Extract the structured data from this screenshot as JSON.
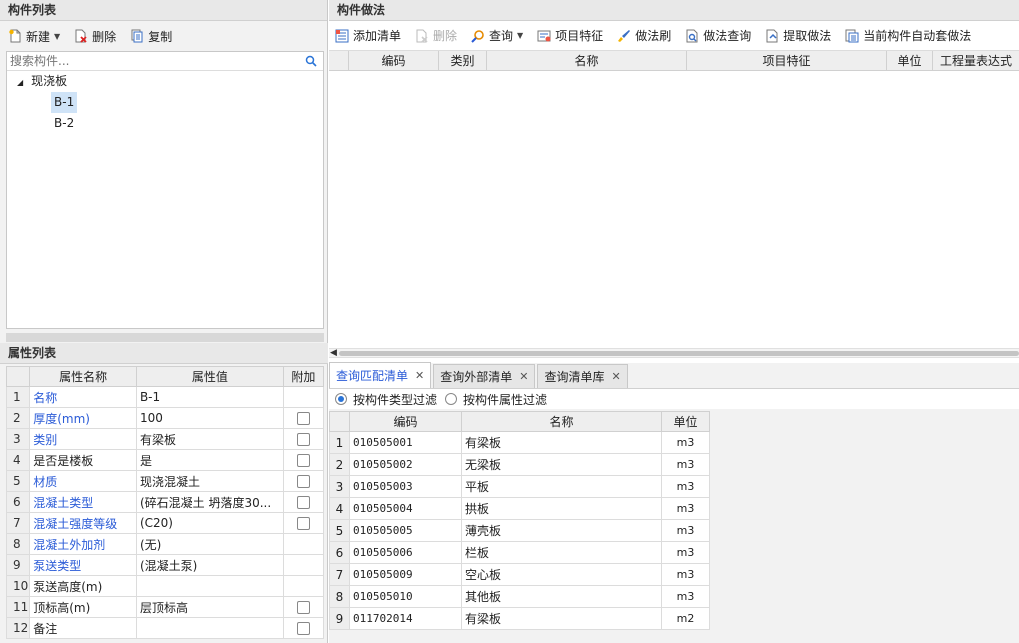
{
  "left": {
    "title": "构件列表",
    "toolbar": {
      "new_label": "新建",
      "delete_label": "删除",
      "copy_label": "复制"
    },
    "search_placeholder": "搜索构件...",
    "tree": {
      "root": "现浇板",
      "children": [
        "B-1",
        "B-2"
      ],
      "selected": "B-1"
    }
  },
  "props": {
    "title": "属性列表",
    "headers": {
      "name": "属性名称",
      "value": "属性值",
      "extra": "附加"
    },
    "rows": [
      {
        "idx": "1",
        "name": "名称",
        "value": "B-1",
        "blue": true,
        "check": false
      },
      {
        "idx": "2",
        "name": "厚度(mm)",
        "value": "100",
        "blue": true,
        "check": true
      },
      {
        "idx": "3",
        "name": "类别",
        "value": "有梁板",
        "blue": true,
        "check": true
      },
      {
        "idx": "4",
        "name": "是否是楼板",
        "value": "是",
        "blue": false,
        "check": true
      },
      {
        "idx": "5",
        "name": "材质",
        "value": "现浇混凝土",
        "blue": true,
        "check": true
      },
      {
        "idx": "6",
        "name": "混凝土类型",
        "value": "(碎石混凝土 坍落度30...",
        "blue": true,
        "check": true
      },
      {
        "idx": "7",
        "name": "混凝土强度等级",
        "value": "(C20)",
        "blue": true,
        "check": true
      },
      {
        "idx": "8",
        "name": "混凝土外加剂",
        "value": "(无)",
        "blue": true,
        "check": false
      },
      {
        "idx": "9",
        "name": "泵送类型",
        "value": "(混凝土泵)",
        "blue": true,
        "check": false
      },
      {
        "idx": "10",
        "name": "泵送高度(m)",
        "value": "",
        "blue": false,
        "check": false
      },
      {
        "idx": "11",
        "name": "顶标高(m)",
        "value": "层顶标高",
        "blue": false,
        "check": true
      },
      {
        "idx": "12",
        "name": "备注",
        "value": "",
        "blue": false,
        "check": true
      }
    ]
  },
  "method": {
    "title": "构件做法",
    "toolbar": {
      "add_list": "添加清单",
      "delete": "删除",
      "query": "查询",
      "item_feature": "项目特征",
      "method_brush": "做法刷",
      "method_query": "做法查询",
      "extract_method": "提取做法",
      "auto_method": "当前构件自动套做法"
    },
    "columns": [
      "编码",
      "类别",
      "名称",
      "项目特征",
      "单位",
      "工程量表达式"
    ]
  },
  "query": {
    "tabs": [
      {
        "label": "查询匹配清单",
        "active": true
      },
      {
        "label": "查询外部清单",
        "active": false
      },
      {
        "label": "查询清单库",
        "active": false
      }
    ],
    "filters": {
      "by_type": "按构件类型过滤",
      "by_attr": "按构件属性过滤"
    },
    "headers": {
      "code": "编码",
      "name": "名称",
      "unit": "单位"
    },
    "rows": [
      {
        "idx": "1",
        "code": "010505001",
        "name": "有梁板",
        "unit": "m3"
      },
      {
        "idx": "2",
        "code": "010505002",
        "name": "无梁板",
        "unit": "m3"
      },
      {
        "idx": "3",
        "code": "010505003",
        "name": "平板",
        "unit": "m3"
      },
      {
        "idx": "4",
        "code": "010505004",
        "name": "拱板",
        "unit": "m3"
      },
      {
        "idx": "5",
        "code": "010505005",
        "name": "薄壳板",
        "unit": "m3"
      },
      {
        "idx": "6",
        "code": "010505006",
        "name": "栏板",
        "unit": "m3"
      },
      {
        "idx": "7",
        "code": "010505009",
        "name": "空心板",
        "unit": "m3"
      },
      {
        "idx": "8",
        "code": "010505010",
        "name": "其他板",
        "unit": "m3"
      },
      {
        "idx": "9",
        "code": "011702014",
        "name": "有梁板",
        "unit": "m2"
      }
    ]
  }
}
